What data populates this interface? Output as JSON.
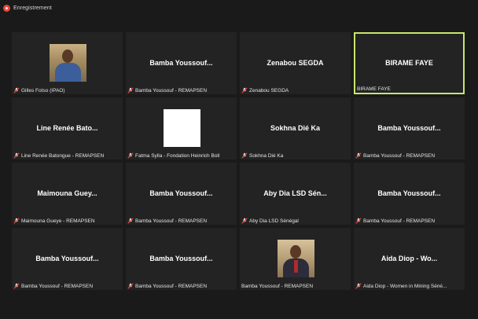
{
  "recording": {
    "label": "Enregistrement",
    "color": "#e8483d"
  },
  "accent": "#c8e66b",
  "participants": [
    {
      "center": "",
      "caption": "Gilles Fotso (IPAO)",
      "muted": true,
      "video": "photo1"
    },
    {
      "center": "Bamba  Youssouf...",
      "caption": "Bamba Youssouf - REMAPSEN",
      "muted": true
    },
    {
      "center": "Zenabou SEGDA",
      "caption": "Zenabou SEGDA",
      "muted": true
    },
    {
      "center": "BIRAME FAYE",
      "caption": "BIRAME FAYE",
      "muted": false,
      "active": true
    },
    {
      "center": "Line Renée Bato...",
      "caption": "Line Renée Batongue - REMAPSEN",
      "muted": true
    },
    {
      "center": "",
      "caption": "Fatma Sylla - Fondation Heinrich Boll",
      "muted": true,
      "video": "white"
    },
    {
      "center": "Sokhna Dié Ka",
      "caption": "Sokhna Dié Ka",
      "muted": true
    },
    {
      "center": "Bamba  Youssouf...",
      "caption": "Bamba Youssouf - REMAPSEN",
      "muted": true
    },
    {
      "center": "Maimouna  Guey...",
      "caption": "Maimouna Gueye - REMAPSEN",
      "muted": true
    },
    {
      "center": "Bamba  Youssouf...",
      "caption": "Bamba Youssouf - REMAPSEN",
      "muted": true
    },
    {
      "center": "Aby Dia LSD Sén...",
      "caption": "Aby Dia LSD Sénégal",
      "muted": true
    },
    {
      "center": "Bamba  Youssouf...",
      "caption": "Bamba Youssouf - REMAPSEN",
      "muted": true
    },
    {
      "center": "Bamba  Youssouf...",
      "caption": "Bamba Youssouf - REMAPSEN",
      "muted": true
    },
    {
      "center": "Bamba  Youssouf...",
      "caption": "Bamba Youssouf - REMAPSEN",
      "muted": true
    },
    {
      "center": "",
      "caption": "Bamba Youssouf - REMAPSEN",
      "muted": false,
      "video": "photo2"
    },
    {
      "center": "Aida  Diop  -  Wo...",
      "caption": "Aida Diop - Women in Mining Séné...",
      "muted": true
    }
  ]
}
